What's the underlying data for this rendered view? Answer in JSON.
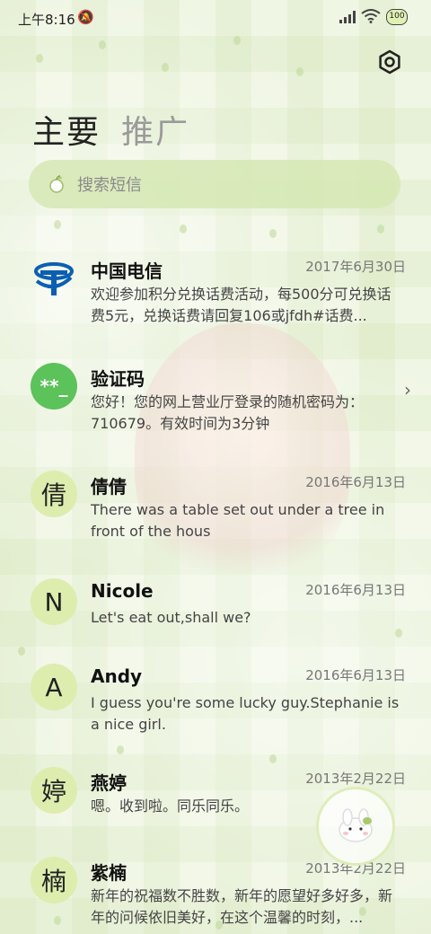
{
  "status_bar": {
    "time": "上午8:16",
    "battery": "100"
  },
  "tabs": [
    {
      "label": "主要",
      "active": true
    },
    {
      "label": "推广",
      "active": false
    }
  ],
  "search": {
    "placeholder": "搜索短信"
  },
  "messages": [
    {
      "name": "中国电信",
      "date": "2017年6月30日",
      "preview": "欢迎参加积分兑换话费活动，每500分可兑换话费5元，兑换话费请回复106或jfdh#话费...",
      "avatar_type": "telecom-logo"
    },
    {
      "name": "验证码",
      "date": "",
      "preview": "您好！您的网上营业厅登录的随机密码为：710679。有效时间为3分钟",
      "avatar_text": "**_",
      "avatar_type": "green"
    },
    {
      "name": "倩倩",
      "date": "2016年6月13日",
      "preview": "There was a table set out under a tree in front of the hous",
      "avatar_text": "倩"
    },
    {
      "name": "Nicole",
      "date": "2016年6月13日",
      "preview": "Let's eat out,shall we?",
      "avatar_text": "N"
    },
    {
      "name": "Andy",
      "date": "2016年6月13日",
      "preview": "I guess you're some lucky guy.Stephanie is a nice girl.",
      "avatar_text": "A"
    },
    {
      "name": "燕婷",
      "date": "2013年2月22日",
      "preview": "嗯。收到啦。同乐同乐。",
      "avatar_text": "婷"
    },
    {
      "name": "紫楠",
      "date": "2013年2月22日",
      "preview": "新年的祝福数不胜数，新年的愿望好多好多，新年的问候依旧美好，在这个温馨的时刻，...",
      "avatar_text": "楠"
    }
  ],
  "colors": {
    "accent": "#dcedae",
    "code_avatar": "#5cc25a",
    "telecom_blue": "#0b5fb3"
  }
}
